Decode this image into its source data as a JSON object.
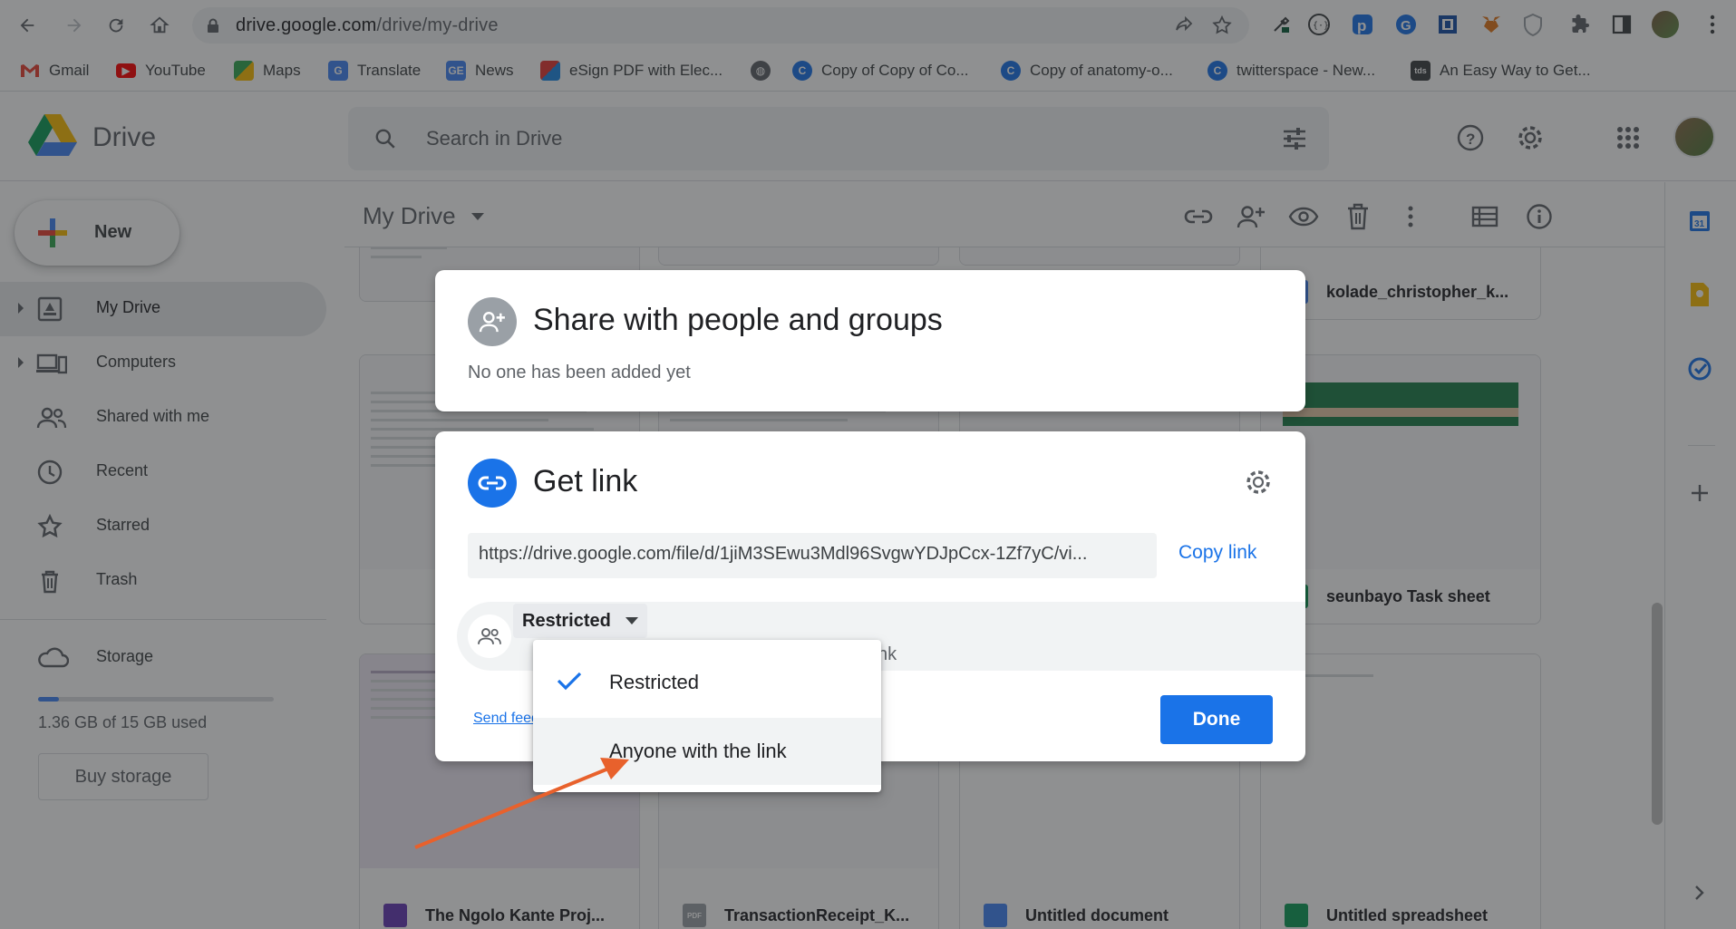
{
  "browser": {
    "url_host": "drive.google.com",
    "url_path": "/drive/my-drive",
    "bookmarks": [
      {
        "label": "Gmail",
        "icon": "gmail-icon",
        "color": "#ea4335"
      },
      {
        "label": "YouTube",
        "icon": "youtube-icon",
        "color": "#ff0000"
      },
      {
        "label": "Maps",
        "icon": "maps-icon",
        "color": "#34a853"
      },
      {
        "label": "Translate",
        "icon": "translate-icon",
        "color": "#4285f4"
      },
      {
        "label": "News",
        "icon": "news-icon",
        "color": "#4285f4"
      },
      {
        "label": "eSign PDF with Elec...",
        "icon": "esign-icon",
        "color": "#e53935"
      },
      {
        "label": "",
        "icon": "globe-icon",
        "color": "#5f6368"
      },
      {
        "label": "Copy of Copy of Co...",
        "icon": "canva-icon",
        "color": "#1a73e8"
      },
      {
        "label": "Copy of anatomy-o...",
        "icon": "canva-icon",
        "color": "#1a73e8"
      },
      {
        "label": "twitterspace - New...",
        "icon": "canva-icon",
        "color": "#1a73e8"
      },
      {
        "label": "An Easy Way to Get...",
        "icon": "tds-icon",
        "color": "#3c4043"
      }
    ]
  },
  "drive": {
    "app_title": "Drive",
    "search_placeholder": "Search in Drive",
    "new_label": "New",
    "nav": [
      {
        "label": "My Drive",
        "icon": "my-drive-icon",
        "active": true
      },
      {
        "label": "Computers",
        "icon": "computers-icon"
      },
      {
        "label": "Shared with me",
        "icon": "shared-icon"
      },
      {
        "label": "Recent",
        "icon": "recent-icon"
      },
      {
        "label": "Starred",
        "icon": "star-icon"
      },
      {
        "label": "Trash",
        "icon": "trash-icon"
      }
    ],
    "storage_label": "Storage",
    "storage_used": "1.36 GB of 15 GB used",
    "storage_fraction": 0.09,
    "buy_storage": "Buy storage",
    "folder_title": "My Drive",
    "files": [
      {
        "name": "kolade_christopher_k...",
        "type": "doc"
      },
      {
        "name": "seunbayo Task sheet",
        "type": "sheet"
      },
      {
        "name": "The Ngolo Kante Proj...",
        "type": "form"
      },
      {
        "name": "TransactionReceipt_K...",
        "type": "pdf"
      },
      {
        "name": "Untitled document",
        "type": "doc"
      },
      {
        "name": "Untitled spreadsheet",
        "type": "sheet"
      }
    ]
  },
  "share_dialog": {
    "title": "Share with people and groups",
    "subtitle": "No one has been added yet"
  },
  "link_dialog": {
    "title": "Get link",
    "url": "https://drive.google.com/file/d/1jiM3SEwu3Mdl96SvgwYDJpCcx-1Zf7yC/vi...",
    "copy_label": "Copy link",
    "access_value": "Restricted",
    "access_hint": "nk",
    "send_feedback": "Send feed",
    "done_label": "Done"
  },
  "dropdown": {
    "options": [
      {
        "label": "Restricted",
        "selected": true
      },
      {
        "label": "Anyone with the link",
        "selected": false
      }
    ]
  },
  "colors": {
    "accent": "#1a73e8",
    "arrow": "#e8612c"
  }
}
